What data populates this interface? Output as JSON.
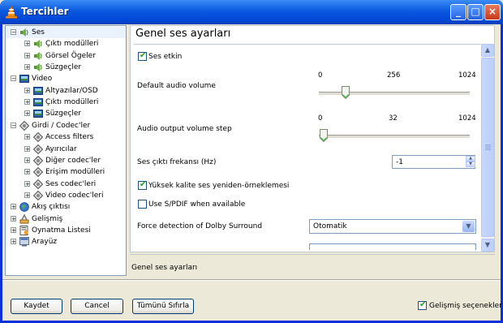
{
  "window": {
    "title": "Tercihler"
  },
  "titlebar_buttons": {
    "minimize": "_",
    "maximize": "□",
    "close": "×"
  },
  "tree": [
    {
      "label": "Ses",
      "expander": "−",
      "icon": "speaker-icon",
      "selected": true
    },
    {
      "label": "Çıktı modülleri",
      "expander": "+",
      "icon": "speaker-icon"
    },
    {
      "label": "Görsel Ögeler",
      "expander": "+",
      "icon": "speaker-icon"
    },
    {
      "label": "Süzgeçler",
      "expander": "+",
      "icon": "speaker-icon"
    },
    {
      "label": "Video",
      "expander": "−",
      "icon": "video-icon"
    },
    {
      "label": "Altyazılar/OSD",
      "expander": "+",
      "icon": "video-icon"
    },
    {
      "label": "Çıktı modülleri",
      "expander": "+",
      "icon": "video-icon"
    },
    {
      "label": "Süzgeçler",
      "expander": "+",
      "icon": "video-icon"
    },
    {
      "label": "Girdi / Codec'ler",
      "expander": "−",
      "icon": "codec-icon"
    },
    {
      "label": "Access filters",
      "expander": "+",
      "icon": "codec-icon"
    },
    {
      "label": "Ayırıcılar",
      "expander": "+",
      "icon": "codec-icon"
    },
    {
      "label": "Diğer codec'ler",
      "expander": "+",
      "icon": "codec-icon"
    },
    {
      "label": "Erişim modülleri",
      "expander": "+",
      "icon": "codec-icon"
    },
    {
      "label": "Ses codec'leri",
      "expander": "+",
      "icon": "codec-icon"
    },
    {
      "label": "Video codec'leri",
      "expander": "+",
      "icon": "codec-icon"
    },
    {
      "label": "Akış çıktısı",
      "expander": "+",
      "icon": "globe-icon"
    },
    {
      "label": "Gelişmiş",
      "expander": "+",
      "icon": "tools-icon"
    },
    {
      "label": "Oynatma Listesi",
      "expander": "+",
      "icon": "playlist-icon"
    },
    {
      "label": "Arayüz",
      "expander": "+",
      "icon": "interface-icon"
    }
  ],
  "panel": {
    "heading": "Genel ses ayarları",
    "ses_etkin": {
      "label": "Ses etkin",
      "checked": true
    },
    "default_volume": {
      "label": "Default audio volume",
      "ticks": [
        "0",
        "256",
        "1024"
      ],
      "value_fraction": 0.18
    },
    "volume_step": {
      "label": "Audio output volume step",
      "ticks": [
        "0",
        "32",
        "1024"
      ],
      "value_fraction": 0.03
    },
    "frequency": {
      "label": "Ses çıktı frekansı (Hz)",
      "value": "-1"
    },
    "resample": {
      "label": "Yüksek kalite ses yeniden-örneklemesi",
      "checked": true
    },
    "spdif": {
      "label": "Use S/PDIF when available",
      "checked": false
    },
    "dolby": {
      "label": "Force detection of Dolby Surround",
      "value": "Otomatik"
    }
  },
  "description": "Genel ses ayarları",
  "buttons": {
    "save": "Kaydet",
    "cancel": "Cancel",
    "reset": "Tümünü Sıfırla"
  },
  "advanced": {
    "label": "Gelişmiş seçenekler",
    "checked": true
  },
  "colors": {
    "titlebar": "#0a58e0",
    "frame": "#0831d9",
    "dialog": "#ece9d8",
    "check": "#21a121"
  }
}
